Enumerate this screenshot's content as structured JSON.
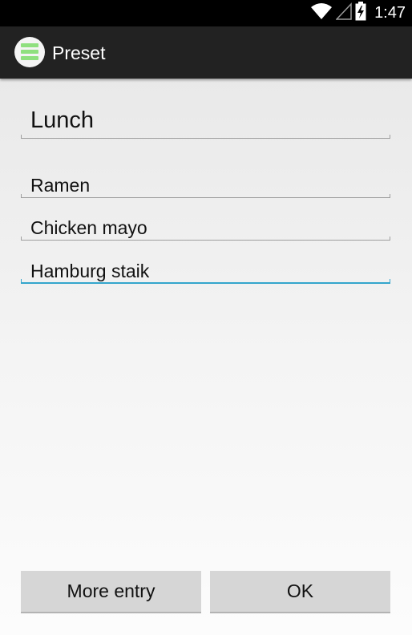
{
  "status_bar": {
    "time": "1:47",
    "icons": [
      "wifi-icon",
      "cell-signal-icon",
      "battery-charging-icon"
    ]
  },
  "action_bar": {
    "title": "Preset",
    "app_icon": "list-icon"
  },
  "form": {
    "preset_name": "Lunch",
    "entries": [
      {
        "value": "Ramen"
      },
      {
        "value": "Chicken mayo"
      },
      {
        "value": "Hamburg staik"
      }
    ]
  },
  "buttons": {
    "more_entry_label": "More entry",
    "ok_label": "OK"
  },
  "colors": {
    "focus_accent": "#33a5cc",
    "app_icon_accent": "#8fe07f",
    "action_bar_bg": "#222222"
  }
}
